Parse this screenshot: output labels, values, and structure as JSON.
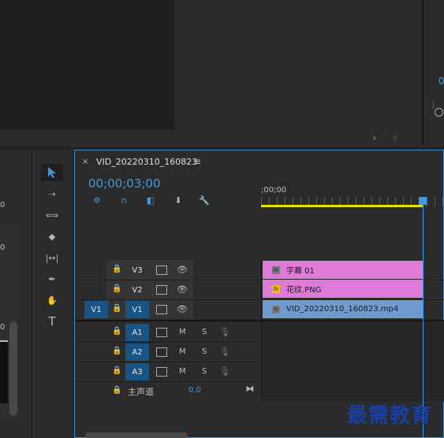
{
  "timeline": {
    "tab_title": "VID_20220310_160823",
    "timecode": "00;00;03;00",
    "ruler_label": ";00;00",
    "tracks": [
      {
        "name": "V3",
        "icon": "film-icon",
        "visibility": "eye-icon"
      },
      {
        "name": "V2",
        "icon": "film-icon",
        "visibility": "eye-icon"
      },
      {
        "name": "V1",
        "source": "V1",
        "icon": "film-icon",
        "visibility": "eye-icon"
      }
    ],
    "audio_tracks": [
      {
        "name": "A1",
        "m": "M",
        "s": "S"
      },
      {
        "name": "A2",
        "m": "M",
        "s": "S"
      },
      {
        "name": "A3",
        "m": "M",
        "s": "S"
      }
    ],
    "master": {
      "label": "主声道",
      "value": "0.0"
    },
    "clips": [
      {
        "name": "字幕 01",
        "fx": "fx",
        "color": "#e07ad8"
      },
      {
        "name": "花纹.PNG",
        "fx": "fx",
        "color": "#e07ad8"
      },
      {
        "name": "VID_20220310_160823.mp4",
        "fx": "fx",
        "color": "#6f9bd0"
      }
    ]
  },
  "left_panel": {
    "frag1": "0",
    "frag2": "0",
    "frag3": "0"
  },
  "right_panel": {
    "timecode_frag": "0"
  },
  "watermark": "最需教育",
  "colors": {
    "accent": "#3c9be6",
    "v_clip": "#e07ad8",
    "a_clip": "#6f9bd0"
  }
}
